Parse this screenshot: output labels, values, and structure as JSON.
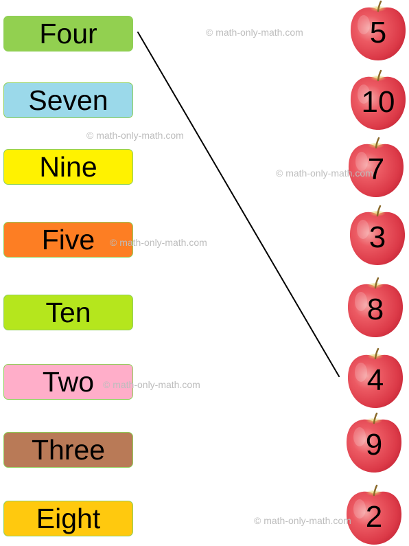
{
  "worksheet": {
    "words": [
      {
        "label": "Four",
        "color": "#92d050"
      },
      {
        "label": "Seven",
        "color": "#9bd9ea"
      },
      {
        "label": "Nine",
        "color": "#fff200"
      },
      {
        "label": "Five",
        "color": "#fd7e23"
      },
      {
        "label": "Ten",
        "color": "#b5e61d"
      },
      {
        "label": "Two",
        "color": "#ffaec9"
      },
      {
        "label": "Three",
        "color": "#b97a57"
      },
      {
        "label": "Eight",
        "color": "#ffc90e"
      }
    ],
    "apples": [
      {
        "number": "5",
        "icon": "apple-icon"
      },
      {
        "number": "10",
        "icon": "apple-icon"
      },
      {
        "number": "7",
        "icon": "apple-icon"
      },
      {
        "number": "3",
        "icon": "apple-icon"
      },
      {
        "number": "8",
        "icon": "apple-icon"
      },
      {
        "number": "4",
        "icon": "apple-icon"
      },
      {
        "number": "9",
        "icon": "apple-icon"
      },
      {
        "number": "2",
        "icon": "apple-icon"
      }
    ],
    "matches": [
      {
        "word": "Four",
        "number": "4"
      }
    ],
    "watermark": "© math-only-math.com",
    "line_color": "#000000"
  }
}
